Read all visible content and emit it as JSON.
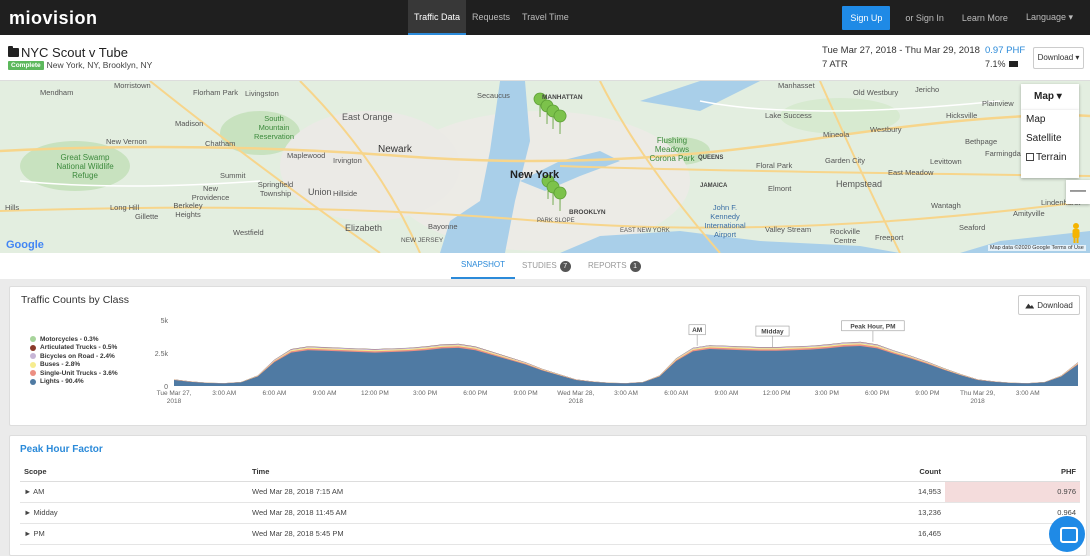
{
  "nav": {
    "logo": "miovision",
    "links": [
      "Traffic Data",
      "Requests",
      "Travel Time"
    ],
    "signup": "Sign Up",
    "signin": "or Sign In",
    "learn": "Learn More",
    "language": "Language ▾"
  },
  "study": {
    "title": "NYC Scout v Tube",
    "status": "Complete",
    "location": "New York, NY, Brooklyn, NY",
    "daterange": "Tue Mar 27, 2018 - Thu Mar 29, 2018",
    "atr": "7 ATR",
    "phf": "0.97 PHF",
    "pct": "7.1%",
    "download": "Download ▾"
  },
  "map": {
    "labels": {
      "morristown": "Morristown",
      "florham": "Florham Park",
      "livingston": "Livingston",
      "east_orange": "East Orange",
      "mendham": "Mendham",
      "madison": "Madison",
      "south_mountain": "South Mountain Reservation",
      "newark": "Newark",
      "new_vernon": "New Vernon",
      "chatham": "Chatham",
      "great_swamp": "Great Swamp National Wildlife Refuge",
      "irvington": "Irvington",
      "maplewood": "Maplewood",
      "summit": "Summit",
      "new_providence": "New Providence",
      "springfield": "Springfield Township",
      "union": "Union",
      "hillside": "Hillside",
      "long_hill": "Long Hill",
      "gillette": "Gillette",
      "berkeley": "Berkeley Heights",
      "westfield": "Westfield",
      "elizabeth": "Elizabeth",
      "bayonne": "Bayonne",
      "new_jersey": "NEW JERSEY",
      "secaucus": "Secaucus",
      "manhattan": "MANHATTAN",
      "new_york": "New York",
      "brooklyn": "BROOKLYN",
      "park_slope": "PARK SLOPE",
      "east_new_york": "EAST NEW YORK",
      "flushing": "Flushing Meadows Corona Park",
      "queens": "QUEENS",
      "jamaica": "JAMAICA",
      "jfk": "John F. Kennedy International Airport",
      "valley_stream": "Valley Stream",
      "rockville": "Rockville Centre",
      "freeport": "Freeport",
      "hempstead": "Hempstead",
      "elmont": "Elmont",
      "garden_city": "Garden City",
      "floral_park": "Floral Park",
      "mineola": "Mineola",
      "westbury": "Westbury",
      "old_westbury": "Old Westbury",
      "east_meadow": "East Meadow",
      "levittown": "Levittown",
      "wantagh": "Wantagh",
      "seaford": "Seaford",
      "hicksville": "Hicksville",
      "bethpage": "Bethpage",
      "plainview": "Plainview",
      "farmingdale": "Farmingdale",
      "amityville": "Amityville",
      "lake_success": "Lake Success",
      "manhasset": "Manhasset",
      "jericho": "Jericho",
      "hills": "Hills",
      "lindenhurst": "Lindenhurst"
    },
    "type_button": "Map ▾",
    "menu": [
      "Map",
      "Satellite",
      "Terrain"
    ],
    "zoom_out": "—",
    "google": "Google",
    "attribution": "Map data ©2020 Google   Terms of Use"
  },
  "tabs": [
    {
      "label": "SNAPSHOT",
      "count": ""
    },
    {
      "label": "STUDIES",
      "count": "7"
    },
    {
      "label": "REPORTS",
      "count": "1"
    }
  ],
  "chart_panel": {
    "title": "Traffic Counts by Class",
    "download": "Download"
  },
  "chart_data": {
    "type": "area",
    "title": "Traffic Counts by Class",
    "stacked": true,
    "ylim": [
      0,
      5000
    ],
    "yticks": [
      "5k",
      "2.5k",
      "0"
    ],
    "xticks": [
      "Tue Mar 27, 2018",
      "3:00 AM",
      "6:00 AM",
      "9:00 AM",
      "12:00 PM",
      "3:00 PM",
      "6:00 PM",
      "9:00 PM",
      "Wed Mar 28, 2018",
      "3:00 AM",
      "6:00 AM",
      "9:00 AM",
      "12:00 PM",
      "3:00 PM",
      "6:00 PM",
      "9:00 PM",
      "Thu Mar 29, 2018",
      "3:00 AM"
    ],
    "legend": [
      {
        "name": "Motorcycles - 0.3%",
        "color": "#a7d49b"
      },
      {
        "name": "Articulated Trucks - 0.5%",
        "color": "#8b3a2b"
      },
      {
        "name": "Bicycles on Road - 2.4%",
        "color": "#c7b5d6"
      },
      {
        "name": "Buses - 2.8%",
        "color": "#f6ec8f"
      },
      {
        "name": "Single-Unit Trucks - 3.6%",
        "color": "#ec8f83"
      },
      {
        "name": "Lights - 90.4%",
        "color": "#4f7aa3"
      }
    ],
    "annotations": [
      "AM",
      "Midday",
      "Peak Hour, PM"
    ],
    "hours": [
      0,
      1,
      2,
      3,
      4,
      5,
      6,
      7,
      8,
      9,
      10,
      11,
      12,
      13,
      14,
      15,
      16,
      17,
      18,
      19,
      20,
      21,
      22,
      23,
      24,
      25,
      26,
      27,
      28,
      29,
      30,
      31,
      32,
      33,
      34,
      35,
      36,
      37,
      38,
      39,
      40,
      41,
      42,
      43,
      44,
      45,
      46,
      47,
      48,
      49,
      50,
      51,
      52,
      53,
      54
    ],
    "total": [
      500,
      350,
      250,
      220,
      300,
      800,
      2000,
      2800,
      3000,
      2950,
      2900,
      2850,
      2800,
      2850,
      2900,
      3000,
      3150,
      3200,
      3000,
      2600,
      2200,
      1800,
      1300,
      900,
      500,
      350,
      250,
      220,
      300,
      800,
      2100,
      2900,
      3100,
      3050,
      3000,
      2950,
      2950,
      3000,
      3050,
      3150,
      3300,
      3350,
      3150,
      2700,
      2300,
      1850,
      1350,
      900,
      500,
      350,
      250,
      220,
      300,
      800,
      1800
    ],
    "lights_share": 0.904
  },
  "phf_panel": {
    "title": "Peak Hour Factor",
    "headers": {
      "scope": "Scope",
      "time": "Time",
      "count": "Count",
      "phf": "PHF"
    },
    "rows": [
      {
        "scope": "► AM",
        "time": "Wed Mar 28, 2018 7:15 AM",
        "count": "14,953",
        "phf": "0.976"
      },
      {
        "scope": "► Midday",
        "time": "Wed Mar 28, 2018 11:45 AM",
        "count": "13,236",
        "phf": "0.964"
      },
      {
        "scope": "► PM",
        "time": "Wed Mar 28, 2018 5:45 PM",
        "count": "16,465",
        "phf": ""
      }
    ]
  }
}
